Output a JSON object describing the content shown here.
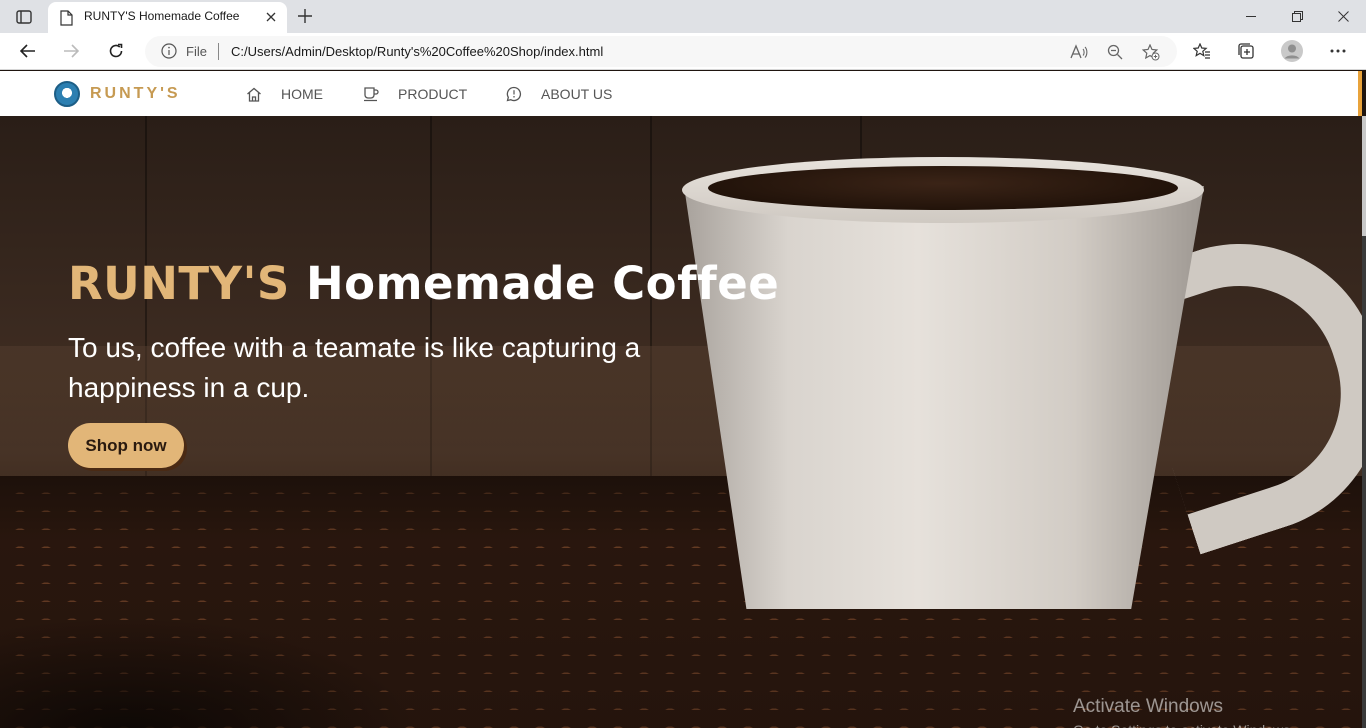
{
  "browser": {
    "tab_title": "RUNTY'S Homemade Coffee",
    "address_scheme_label": "File",
    "url": "C:/Users/Admin/Desktop/Runty's%20Coffee%20Shop/index.html"
  },
  "site": {
    "logo_text": "RUNTY'S",
    "nav": [
      {
        "label": "HOME",
        "icon": "home-icon"
      },
      {
        "label": "PRODUCT",
        "icon": "coffee-cup-icon"
      },
      {
        "label": "ABOUT US",
        "icon": "chat-info-icon"
      }
    ]
  },
  "hero": {
    "title_brand": "RUNTY'S",
    "title_rest": "Homemade Coffee",
    "subtitle": "To us, coffee with a teamate is like capturing a happiness in a cup.",
    "cta_label": "Shop now"
  },
  "watermark": {
    "title": "Activate Windows",
    "subtitle": "Go to Settings to activate Windows."
  },
  "colors": {
    "brand_gold": "#e2b678",
    "logo_gold": "#c69a52",
    "nav_text": "#555555"
  }
}
